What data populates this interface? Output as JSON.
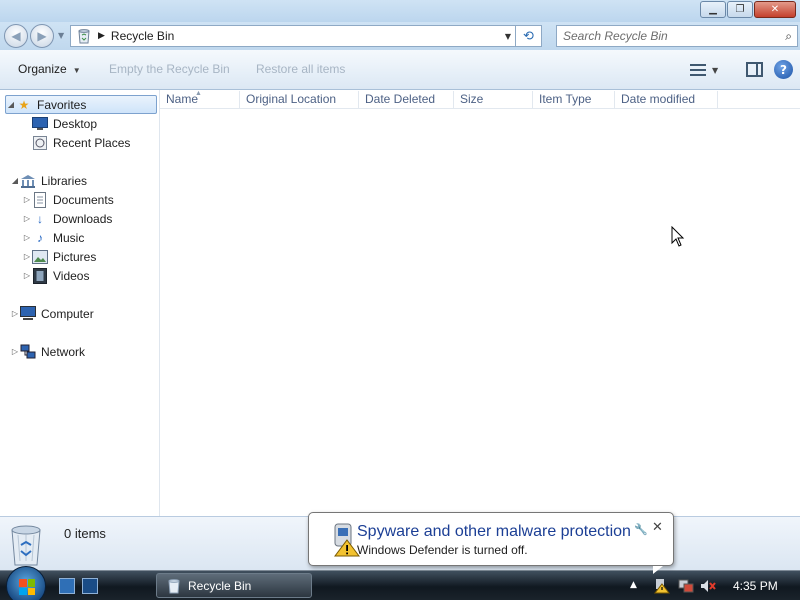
{
  "window": {
    "minimize_glyph": "▁",
    "maximize_glyph": "❐",
    "close_glyph": "✕"
  },
  "address": {
    "crumb": "Recycle Bin",
    "refresh_glyph": "⟲",
    "search_placeholder": "Search Recycle Bin"
  },
  "toolbar": {
    "organize": "Organize",
    "empty_bin": "Empty the Recycle Bin",
    "restore_all": "Restore all items",
    "help_glyph": "?"
  },
  "navpane": {
    "favorites": {
      "label": "Favorites",
      "children": [
        "Desktop",
        "Recent Places"
      ]
    },
    "libraries": {
      "label": "Libraries",
      "children": [
        "Documents",
        "Downloads",
        "Music",
        "Pictures",
        "Videos"
      ]
    },
    "computer": "Computer",
    "network": "Network"
  },
  "columns": [
    "Name",
    "Original Location",
    "Date Deleted",
    "Size",
    "Item Type",
    "Date modified"
  ],
  "status": {
    "items": "0 items"
  },
  "taskbar": {
    "task_label": "Recycle Bin",
    "clock": "4:35 PM"
  },
  "balloon": {
    "title": "Spyware and other malware protection",
    "body": "Windows Defender is turned off."
  },
  "colors": {
    "accent": "#1c3f95",
    "header_text": "#4d6185",
    "disabled_text": "#a7b5c4"
  }
}
